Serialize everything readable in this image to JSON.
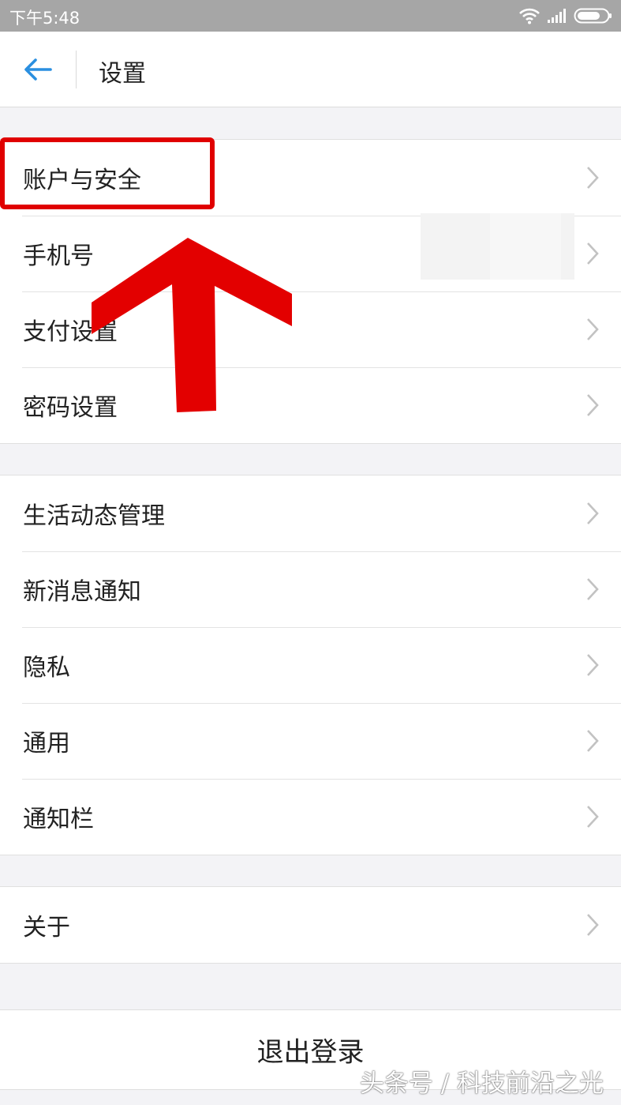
{
  "status_bar": {
    "time": "下午5:48",
    "icons": [
      "wifi-icon",
      "signal-icon",
      "battery-icon"
    ]
  },
  "header": {
    "back_icon": "back-arrow-icon",
    "title": "设置"
  },
  "groups": [
    {
      "items": [
        {
          "label": "账户与安全"
        },
        {
          "label": "手机号"
        },
        {
          "label": "支付设置"
        },
        {
          "label": "密码设置"
        }
      ]
    },
    {
      "items": [
        {
          "label": "生活动态管理"
        },
        {
          "label": "新消息通知"
        },
        {
          "label": "隐私"
        },
        {
          "label": "通用"
        },
        {
          "label": "通知栏"
        }
      ]
    },
    {
      "items": [
        {
          "label": "关于"
        }
      ]
    }
  ],
  "logout": {
    "label": "退出登录"
  },
  "watermark": {
    "text": "头条号 / 科技前沿之光"
  },
  "colors": {
    "status_bar_bg": "#a6a6a6",
    "accent_blue": "#2a8fe0",
    "annotation_red": "#e00000",
    "page_bg": "#f3f3f6"
  }
}
